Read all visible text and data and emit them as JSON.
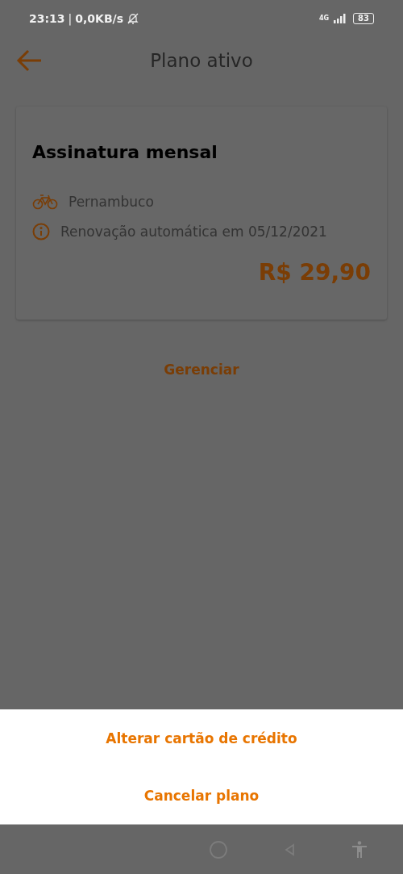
{
  "status_bar": {
    "time": "23:13",
    "separator": "|",
    "network_speed": "0,0KB/s",
    "network_type": "4G",
    "battery": "83"
  },
  "header": {
    "title": "Plano ativo"
  },
  "plan_card": {
    "title": "Assinatura mensal",
    "details": [
      {
        "kind": "bike",
        "text": "Pernambuco"
      },
      {
        "kind": "info",
        "text": "Renovação automática em 05/12/2021"
      }
    ],
    "price": "R$ 29,90"
  },
  "manage_link": "Gerenciar",
  "action_sheet": [
    "Alterar cartão de crédito",
    "Cancelar plano"
  ]
}
